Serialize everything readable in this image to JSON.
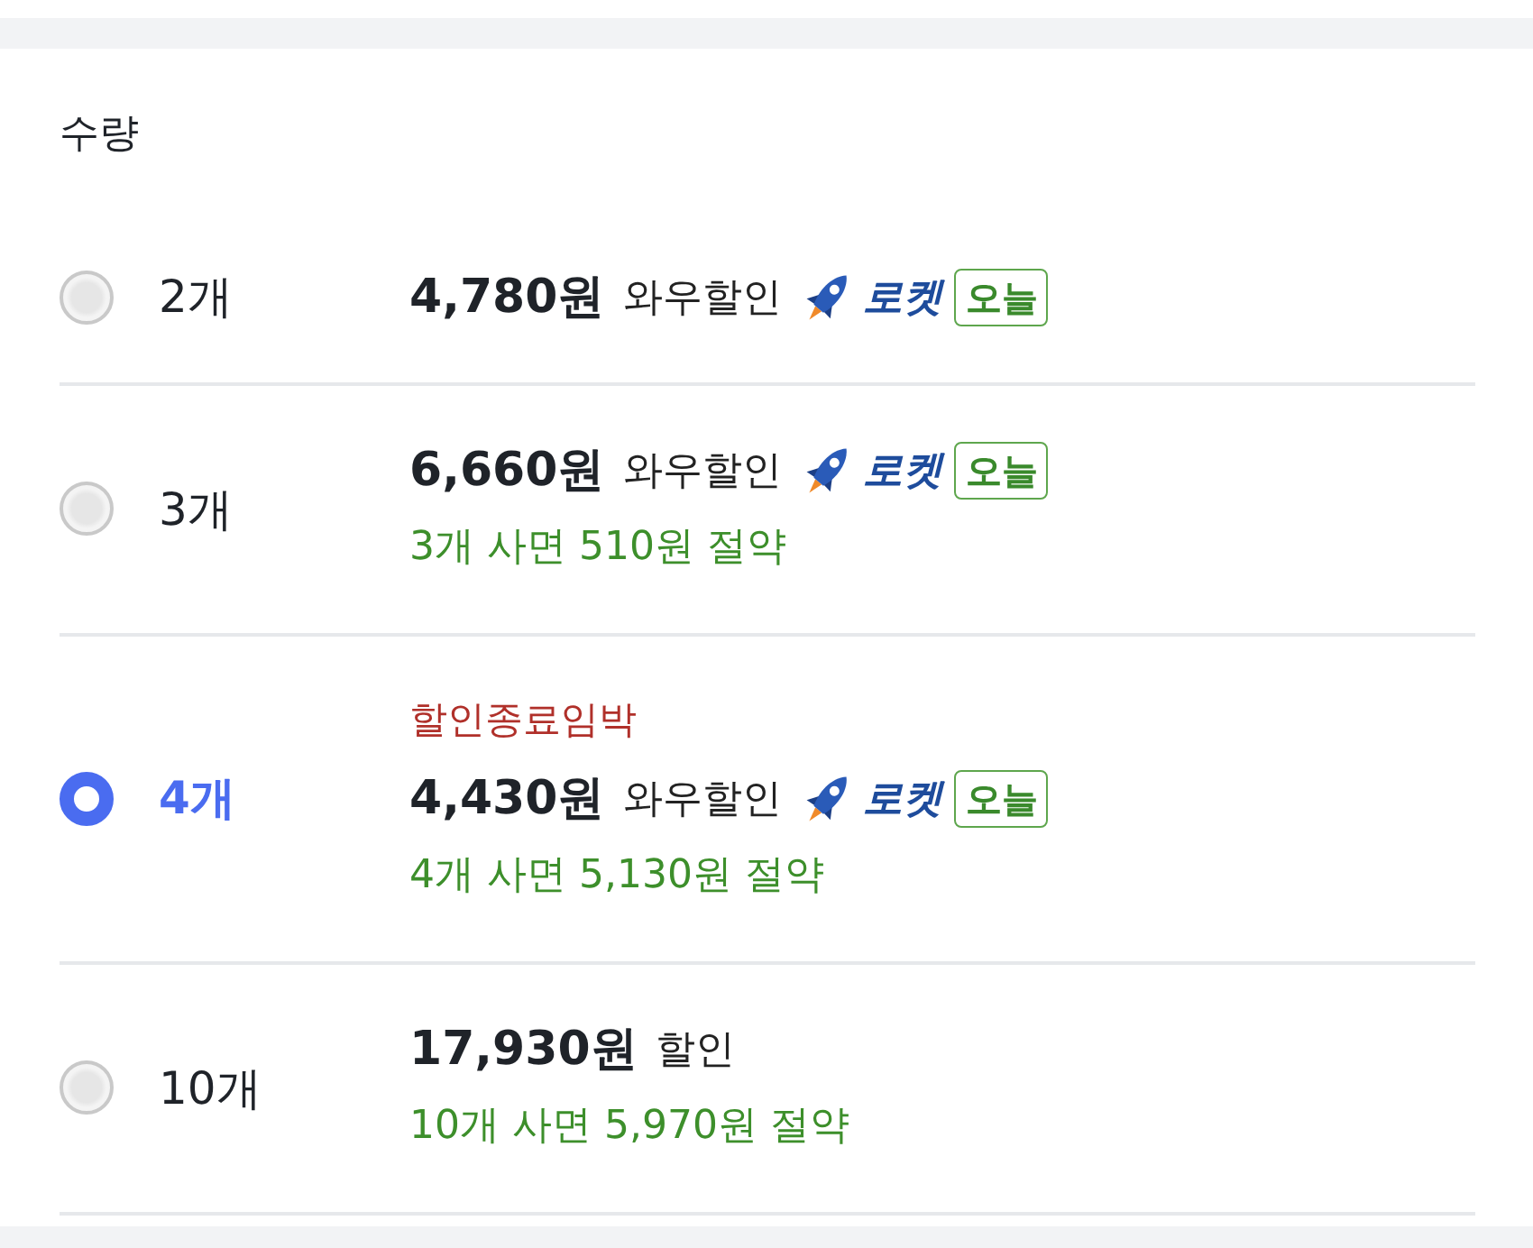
{
  "section": {
    "title": "수량"
  },
  "options": [
    {
      "quantity": "2개",
      "selected": false,
      "price": "4,780원",
      "discount": "와우할인",
      "delivery": {
        "brand": "로켓",
        "tag": "오늘"
      }
    },
    {
      "quantity": "3개",
      "selected": false,
      "price": "6,660원",
      "discount": "와우할인",
      "delivery": {
        "brand": "로켓",
        "tag": "오늘"
      },
      "savings": "3개 사면 510원 절약"
    },
    {
      "quantity": "4개",
      "selected": true,
      "notice": "할인종료임박",
      "price": "4,430원",
      "discount": "와우할인",
      "delivery": {
        "brand": "로켓",
        "tag": "오늘"
      },
      "savings": "4개 사면 5,130원 절약"
    },
    {
      "quantity": "10개",
      "selected": false,
      "price": "17,930원",
      "discount": "할인",
      "savings": "10개 사면 5,970원 절약"
    }
  ]
}
